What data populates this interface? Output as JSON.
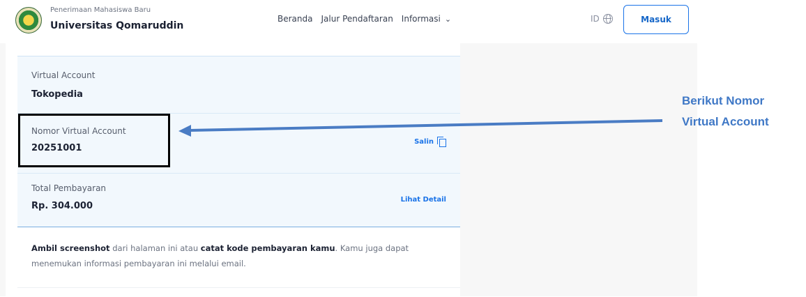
{
  "header": {
    "brand_subtitle": "Penerimaan Mahasiswa Baru",
    "brand_title": "Universitas Qomaruddin",
    "nav": [
      "Beranda",
      "Jalur Pendaftaran",
      "Informasi"
    ],
    "language": "ID",
    "login_label": "Masuk"
  },
  "payment": {
    "method_label": "Virtual Account",
    "method_value": "Tokopedia",
    "va_label": "Nomor Virtual Account",
    "va_number": "20251001",
    "copy_label": "Salin",
    "total_label": "Total Pembayaran",
    "total_value": "Rp. 304.000",
    "detail_label": "Lihat Detail"
  },
  "note": {
    "part1": "Ambil screenshot",
    "part2": " dari halaman ini atau ",
    "part3": "catat kode pembayaran kamu",
    "part4": ". Kamu juga dapat menemukan informasi pembayaran ini melalui email."
  },
  "annotation": {
    "line1": "Berikut Nomor",
    "line2": "Virtual Account",
    "color": "#3f78c6"
  },
  "colors": {
    "accent": "#1a73e8",
    "row_background": "#f2f8fd"
  }
}
